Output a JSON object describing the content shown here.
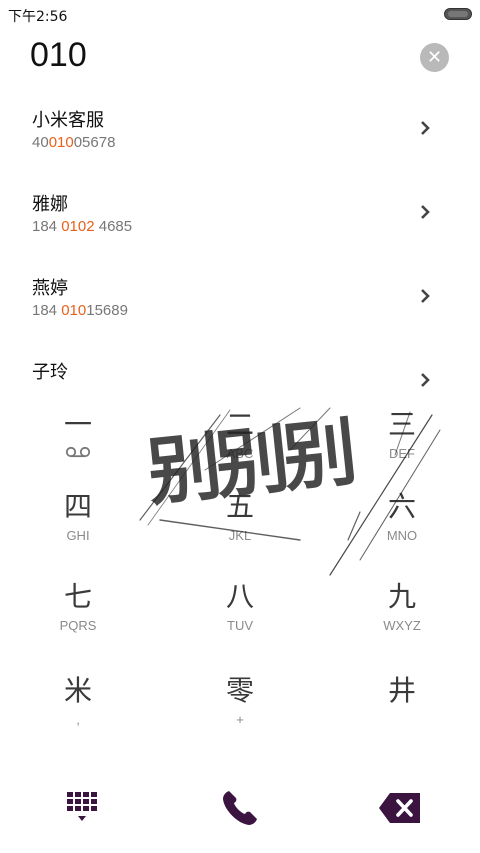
{
  "status_bar": {
    "time": "下午2:56"
  },
  "dial_input": {
    "value": "010"
  },
  "results": [
    {
      "name": "小米客服",
      "number_pre": "40",
      "number_match": "010",
      "number_post": "05678"
    },
    {
      "name": "雅娜",
      "number_pre": "184 ",
      "number_match": "0102",
      "number_post": " 4685"
    },
    {
      "name": "燕婷",
      "number_pre": "184 ",
      "number_match": "010",
      "number_post": "15689"
    },
    {
      "name": "子玲",
      "number_pre": "",
      "number_match": "",
      "number_post": ""
    }
  ],
  "keypad": {
    "keys": [
      {
        "glyph": "一",
        "sub": ""
      },
      {
        "glyph": "二",
        "sub": "ABC"
      },
      {
        "glyph": "三",
        "sub": "DEF"
      },
      {
        "glyph": "四",
        "sub": "GHI"
      },
      {
        "glyph": "五",
        "sub": "JKL"
      },
      {
        "glyph": "六",
        "sub": "MNO"
      },
      {
        "glyph": "七",
        "sub": "PQRS"
      },
      {
        "glyph": "八",
        "sub": "TUV"
      },
      {
        "glyph": "九",
        "sub": "WXYZ"
      },
      {
        "glyph": "米",
        "sub": ","
      },
      {
        "glyph": "零",
        "sub": "+"
      },
      {
        "glyph": "井",
        "sub": ""
      }
    ],
    "overlay_text": "别别别"
  },
  "colors": {
    "accent": "#e8601c",
    "action": "#3b1440"
  },
  "icons": {
    "clear": "clear-icon",
    "chevron": "chevron-right-icon",
    "dialpad": "dialpad-icon",
    "call": "phone-icon",
    "backspace": "backspace-icon",
    "voicemail": "voicemail-icon"
  }
}
